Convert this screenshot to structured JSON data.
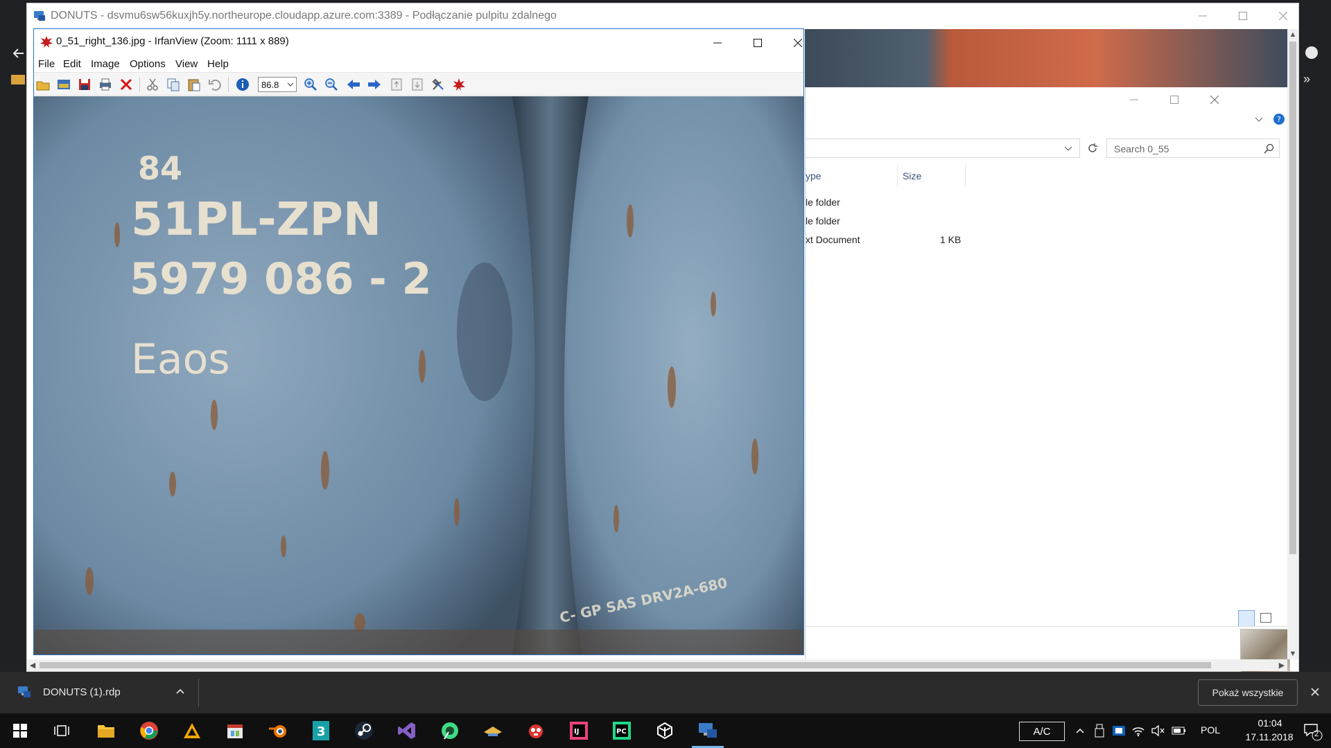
{
  "rdp": {
    "title": "DONUTS - dsvmu6sw56kuxjh5y.northeurope.cloudapp.azure.com:3389 - Podłączanie pulpitu zdalnego"
  },
  "irfanview": {
    "title": "0_51_right_136.jpg - IrfanView (Zoom: 1111 x 889)",
    "menu": [
      "File",
      "Edit",
      "Image",
      "Options",
      "View",
      "Help"
    ],
    "zoom_value": "86.8",
    "toolbar_icons": [
      "open-icon",
      "thumbnails-icon",
      "save-icon",
      "print-icon",
      "delete-icon",
      "cut-icon",
      "copy-icon",
      "paste-icon",
      "undo-icon",
      "info-icon",
      "zoom-in-icon",
      "zoom-out-icon",
      "previous-icon",
      "next-icon",
      "page-first-icon",
      "page-last-icon",
      "settings-icon",
      "irfanview-icon"
    ]
  },
  "image_text": {
    "line1": "84",
    "line2": "51PL-ZPN",
    "line3": "5979 086 - 2",
    "line4": "Eaos",
    "bottom": "C- GP  SAS  DRV2A-680"
  },
  "explorer": {
    "search_placeholder": "Search 0_55",
    "columns": {
      "type": "ype",
      "size": "Size"
    },
    "rows": [
      {
        "type": "le folder",
        "size": ""
      },
      {
        "type": "le folder",
        "size": ""
      },
      {
        "type": "xt Document",
        "size": "1 KB"
      }
    ]
  },
  "download_bar": {
    "file_name": "DONUTS (1).rdp",
    "show_all": "Pokaż wszystkie"
  },
  "taskbar": {
    "apps": [
      "windows-start-icon",
      "task-view-icon",
      "file-explorer-icon",
      "chrome-icon",
      "warning-app-icon",
      "clapper-icon",
      "blender-icon",
      "3ds-max-icon",
      "steam-icon",
      "visual-studio-icon",
      "android-studio-icon",
      "hat-app-icon",
      "bug-app-icon",
      "intellij-icon",
      "pycharm-icon",
      "unity-icon",
      "remote-desktop-icon"
    ],
    "ime": "A/C",
    "language": "POL",
    "time": "01:04",
    "date": "17.11.2018",
    "notifications": "2"
  },
  "colors": {
    "irfan_border": "#2b72c2",
    "taskbar": "#101010",
    "download_bar": "#2b2b2b",
    "active_indicator": "#76b9ed"
  }
}
